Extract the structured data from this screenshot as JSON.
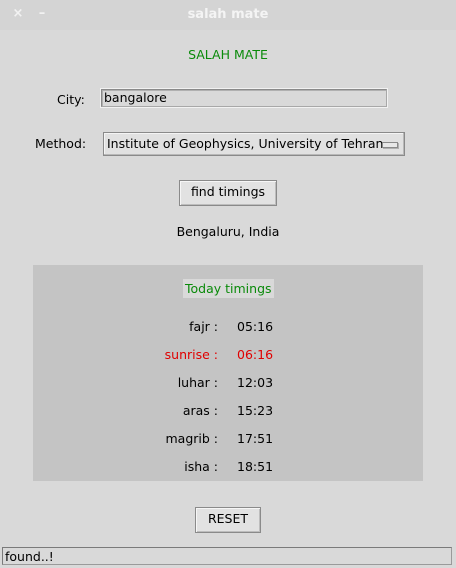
{
  "window": {
    "title": "salah mate",
    "close_icon": "×",
    "minimize_icon": "–"
  },
  "app": {
    "heading": "SALAH MATE"
  },
  "form": {
    "city_label": "City:",
    "city_value": "bangalore",
    "method_label": "Method:",
    "method_value": "Institute of Geophysics, University of Tehran"
  },
  "actions": {
    "find_label": "find timings",
    "reset_label": "RESET"
  },
  "result": {
    "location": "Bengaluru, India",
    "heading": "Today timings",
    "timings": [
      {
        "name": "fajr :",
        "time": "05:16",
        "highlight": false
      },
      {
        "name": "sunrise :",
        "time": "06:16",
        "highlight": true
      },
      {
        "name": "luhar :",
        "time": "12:03",
        "highlight": false
      },
      {
        "name": "aras :",
        "time": "15:23",
        "highlight": false
      },
      {
        "name": "magrib :",
        "time": "17:51",
        "highlight": false
      },
      {
        "name": "isha :",
        "time": "18:51",
        "highlight": false
      }
    ]
  },
  "status": {
    "text": "found..!"
  },
  "colors": {
    "accent_green": "#0a8a0a",
    "highlight_red": "#e00000"
  }
}
